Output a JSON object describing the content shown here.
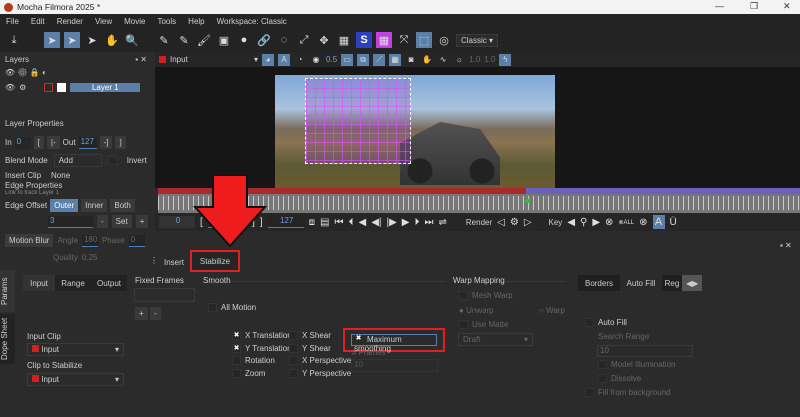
{
  "app": {
    "title": "Mocha Filmora 2025 *"
  },
  "menu": [
    "File",
    "Edit",
    "Render",
    "View",
    "Movie",
    "Tools",
    "Help",
    "Workspace: Classic"
  ],
  "toolbar": {
    "workspace_select": "Classic"
  },
  "layers_panel": {
    "title": "Layers",
    "layer_name": "Layer 1"
  },
  "viewer": {
    "clip_select": "Input",
    "opacity": "0.5",
    "gain1": "1.0",
    "gain2": "1.0"
  },
  "layer_properties": {
    "title": "Layer Properties",
    "in_label": "In",
    "in_value": "0",
    "out_label": "Out",
    "out_value": "127",
    "blend_label": "Blend Mode",
    "blend_value": "Add",
    "invert_label": "Invert",
    "insert_clip_label": "Insert Clip",
    "insert_clip_value": "None"
  },
  "edge_properties": {
    "title": "Edge Properties",
    "link_label": "Link to track",
    "link_value": "Layer 1",
    "offset_label": "Edge Offset",
    "outer": "Outer",
    "inner": "Inner",
    "both": "Both",
    "value": "3",
    "minus": "-",
    "set": "Set",
    "plus": "+",
    "motion_blur": "Motion Blur",
    "angle_label": "Angle",
    "angle_value": "180",
    "phase_label": "Phase",
    "phase_value": "0",
    "quality_label": "Quality",
    "quality_value": "0.25"
  },
  "transport": {
    "start": "0",
    "in": "127",
    "current": "127",
    "render_label": "Render",
    "key_label": "Key",
    "all_label": "ALL"
  },
  "module_tabs": {
    "insert": "Insert",
    "stabilize": "Stabilize"
  },
  "side_tabs": [
    "Params",
    "Dope Sheet"
  ],
  "stabilize": {
    "tabs": [
      "Input",
      "Range",
      "Output"
    ],
    "input_clip_label": "Input Clip",
    "input_clip_value": "Input",
    "clip_to_stabilize_label": "Clip to Stabilize",
    "clip_to_stabilize_value": "Input",
    "fixed_frames_label": "Fixed Frames",
    "add": "+",
    "remove": "-",
    "smooth_label": "Smooth",
    "all_motion": "All Motion",
    "motion": [
      {
        "label": "X Translation",
        "checked": true
      },
      {
        "label": "Y Translation",
        "checked": true
      },
      {
        "label": "Rotation",
        "checked": false
      },
      {
        "label": "Zoom",
        "checked": false
      }
    ],
    "motion2": [
      {
        "label": "X Shear",
        "checked": false
      },
      {
        "label": "Y Shear",
        "checked": false
      },
      {
        "label": "X Perspective",
        "checked": false
      },
      {
        "label": "Y Perspective",
        "checked": false
      }
    ],
    "max_smoothing": "Maximum smoothing",
    "frames_label": "# Frames",
    "frames_value": "10"
  },
  "warp": {
    "title": "Warp Mapping",
    "mesh_warp": "Mesh Warp",
    "unwarp": "Unwarp",
    "warp": "Warp",
    "use_matte": "Use Matte",
    "quality": "Draft"
  },
  "output_tabs": [
    "Borders",
    "Auto Fill",
    "Reg"
  ],
  "autofill": {
    "auto_fill": "Auto Fill",
    "search_range_label": "Search Range",
    "search_range_value": "10",
    "model_illum": "Model Illumination",
    "dissolve": "Dissolve",
    "fill_bg": "Fill from background"
  },
  "colors": {
    "accent": "#5a7fa8",
    "highlight": "#e02020"
  }
}
